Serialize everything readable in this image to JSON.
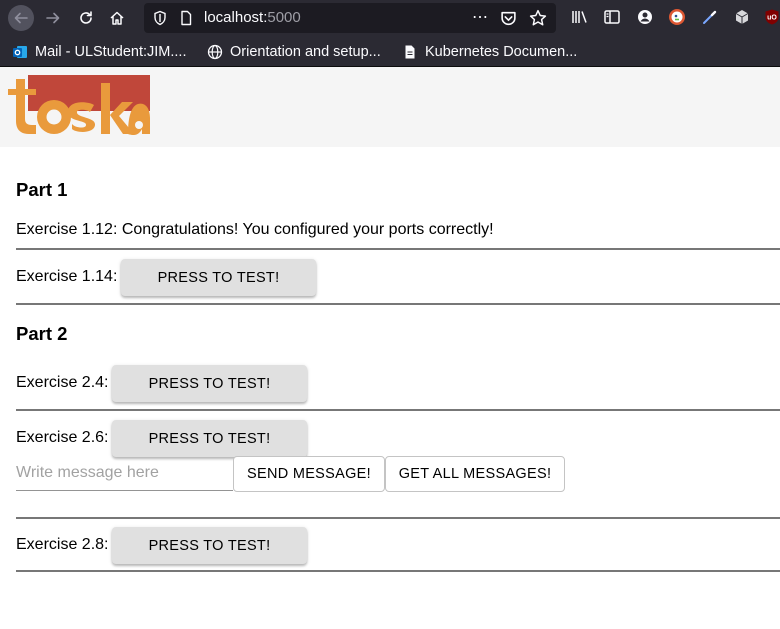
{
  "browser": {
    "url_host": "localhost:",
    "url_port": "5000",
    "page_actions_icon": "⋯",
    "bookmarks": [
      {
        "label": "Mail - ULStudent:JIM....",
        "icon": "outlook-icon"
      },
      {
        "label": "Orientation and setup...",
        "icon": "globe-icon"
      },
      {
        "label": "Kubernetes Documen...",
        "icon": "document-icon"
      }
    ]
  },
  "header": {
    "logo_text": "toska",
    "logo_colors": {
      "orange": "#e99a3c",
      "red": "#c0473a"
    }
  },
  "part1": {
    "title": "Part 1",
    "exercise_112": "Exercise 1.12: Congratulations! You configured your ports correctly!",
    "exercise_114_label": "Exercise 1.14:",
    "exercise_114_button": "PRESS TO TEST!"
  },
  "part2": {
    "title": "Part 2",
    "exercise_24_label": "Exercise 2.4:",
    "exercise_24_button": "PRESS TO TEST!",
    "exercise_26_label": "Exercise 2.6:",
    "exercise_26_button": "PRESS TO TEST!",
    "message_placeholder": "Write message here",
    "send_button": "SEND MESSAGE!",
    "get_all_button": "GET ALL MESSAGES!",
    "exercise_28_label": "Exercise 2.8:",
    "exercise_28_button": "PRESS TO TEST!"
  }
}
